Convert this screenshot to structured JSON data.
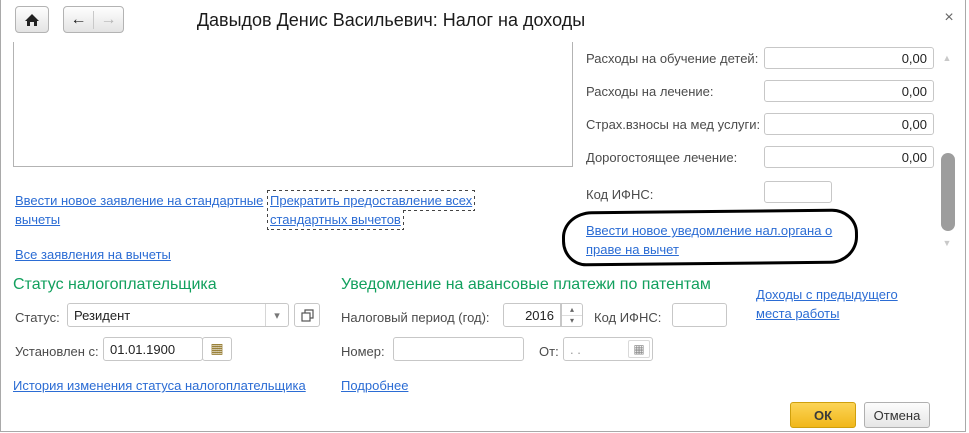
{
  "window": {
    "title": "Давыдов Денис Васильевич: Налог на доходы"
  },
  "icons": {
    "back": "←",
    "forward": "→",
    "close": "×",
    "dropdown": "▾",
    "spinner_up": "▴",
    "spinner_down": "▾",
    "calendar": "▦",
    "scroll_up": "▲",
    "scroll_down": "▼"
  },
  "deduction_links": {
    "new_standard": "Ввести новое заявление на стандартные вычеты",
    "stop_all_standard": "Прекратить предоставление всех стандартных вычетов",
    "all_applications": "Все заявления на вычеты"
  },
  "social": {
    "rows": [
      {
        "label": "Расходы на обучение детей:",
        "value": "0,00"
      },
      {
        "label": "Расходы на лечение:",
        "value": "0,00"
      },
      {
        "label": "Страх.взносы на мед услуги:",
        "value": "0,00"
      },
      {
        "label": "Дорогостоящее лечение:",
        "value": "0,00"
      }
    ],
    "ifns_label": "Код ИФНС:",
    "ifns_value": "",
    "notice_link": "Ввести новое уведомление нал.органа о праве на вычет"
  },
  "status_section": {
    "header": "Статус налогоплательщика",
    "status_label": "Статус:",
    "status_value": "Резидент",
    "set_from_label": "Установлен с:",
    "set_from_value": "01.01.1900",
    "history_link": "История изменения статуса налогоплательщика"
  },
  "patent_section": {
    "header": "Уведомление на авансовые платежи по патентам",
    "period_label": "Налоговый период (год):",
    "period_value": "2016",
    "ifns_label": "Код ИФНС:",
    "ifns_value": "",
    "number_label": "Номер:",
    "number_value": "",
    "from_label": "От:",
    "from_placeholder": ". .",
    "details_link": "Подробнее"
  },
  "prev_income_link": "Доходы с предыдущего места работы",
  "footer": {
    "ok": "ОК",
    "cancel": "Отмена"
  },
  "colors": {
    "link_blue": "#2b6cd4",
    "accent_green": "#12a05e",
    "label_color": "#4b4b4b",
    "field_border": "#c7c7c7",
    "window_border": "#a9a9a9",
    "ok_top": "#fcd456",
    "ok_bottom": "#f1b71a",
    "ok_border": "#cfa00d",
    "annotation_black": "#000000",
    "calendar_olive": "#8a6d1a",
    "scroll_thumb": "#9d9d9d"
  }
}
